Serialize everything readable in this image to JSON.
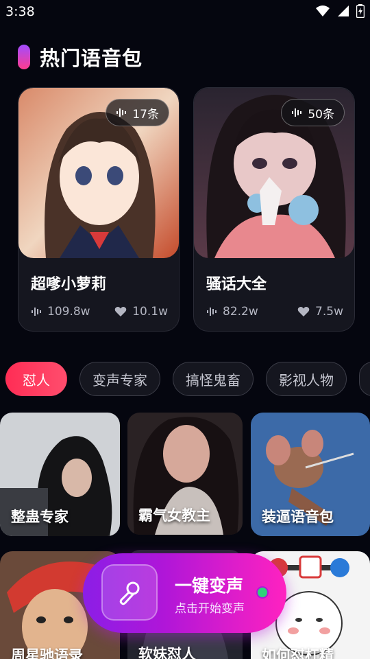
{
  "status_bar": {
    "time": "3:38"
  },
  "section": {
    "title": "热门语音包"
  },
  "hot_cards": [
    {
      "title": "超嗲小萝莉",
      "count": "17条",
      "plays": "109.8w",
      "likes": "10.1w"
    },
    {
      "title": "骚话大全",
      "count": "50条",
      "plays": "82.2w",
      "likes": "7.5w"
    }
  ],
  "tabs": [
    {
      "label": "怼人",
      "active": true
    },
    {
      "label": "变声专家",
      "active": false
    },
    {
      "label": "搞怪鬼畜",
      "active": false
    },
    {
      "label": "影视人物",
      "active": false
    }
  ],
  "grid_items": [
    {
      "label": "整蛊专家"
    },
    {
      "label": "霸气女教主"
    },
    {
      "label": "装逼语音包"
    },
    {
      "label": "周星驰语录"
    },
    {
      "label": "软妹怼人"
    },
    {
      "label": "如何怼杠精"
    }
  ],
  "fab": {
    "title": "一键变声",
    "subtitle": "点击开始变声"
  },
  "colors": {
    "accent_pink": "#ff2d55",
    "fab_start": "#8b1ee6",
    "fab_end": "#ff22c0",
    "online_dot": "#2fd27a"
  }
}
